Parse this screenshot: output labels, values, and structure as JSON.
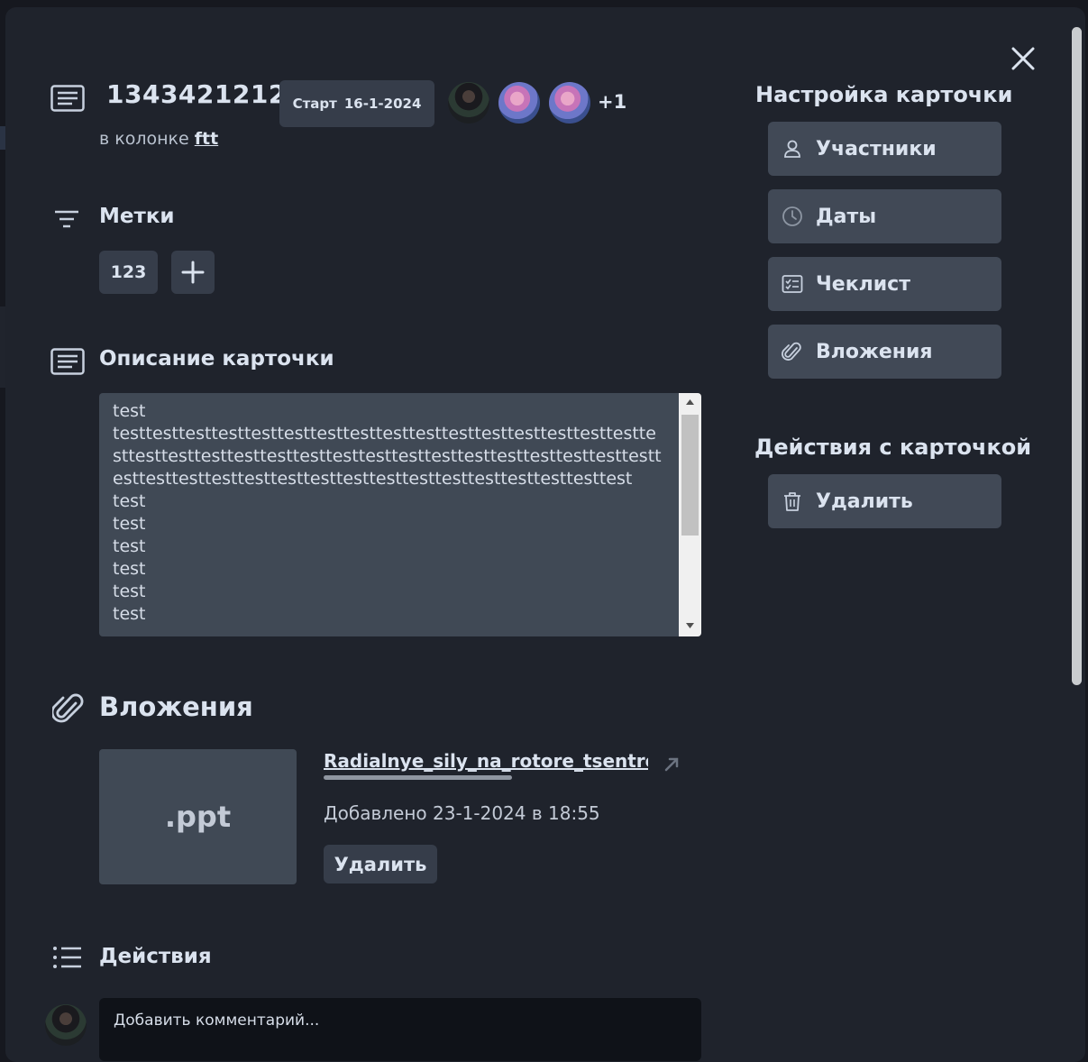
{
  "card": {
    "title": "1343421212",
    "start_label": "Старт",
    "start_date": "16-1-2024",
    "extra_members": "+1",
    "column_prefix": "в колонке",
    "column_name": "ftt"
  },
  "labels": {
    "title": "Метки",
    "items": [
      "123"
    ]
  },
  "description": {
    "title": "Описание карточки",
    "text": "test\ntesttesttesttesttesttesttesttesttesttesttesttesttesttesttesttesttesttesttesttesttesttesttesttesttesttesttesttesttesttesttesttesttesttesttesttesttesttesttesttesttesttesttesttesttesttesttesttesttest\ntest\ntest\ntest\ntest\ntest\ntest"
  },
  "attachments": {
    "title": "Вложения",
    "file": {
      "extension": ".ppt",
      "name": "Radialnye_sily_na_rotore_tsentrobezhnogo",
      "added": "Добавлено 23-1-2024 в 18:55",
      "delete_label": "Удалить",
      "upload_progress": 0.58
    }
  },
  "activity": {
    "title": "Действия",
    "comment_placeholder": "Добавить комментарий..."
  },
  "sidebar": {
    "settings_title": "Настройка карточки",
    "buttons": [
      "Участники",
      "Даты",
      "Чеклист",
      "Вложения"
    ],
    "actions_title": "Действия с карточкой",
    "delete_label": "Удалить"
  },
  "colors": {
    "modal_bg": "#1f232c",
    "button_bg": "#414956",
    "input_bg": "#404955",
    "text": "#dbe3ef"
  }
}
